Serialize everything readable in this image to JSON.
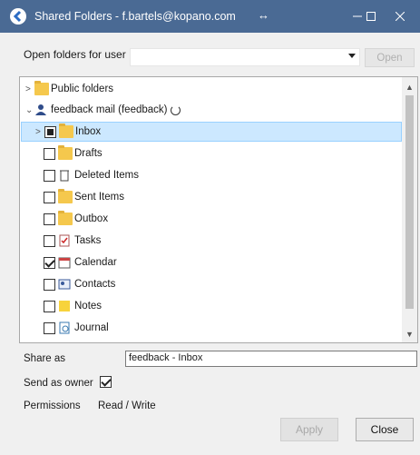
{
  "window": {
    "title": "Shared Folders - f.bartels@kopano.com"
  },
  "open_row": {
    "label": "Open folders for user",
    "input_value": "",
    "open_label": "Open"
  },
  "tree": {
    "public": "Public folders",
    "store": "feedback mail (feedback)",
    "inbox": "Inbox",
    "drafts": "Drafts",
    "deleted": "Deleted Items",
    "sent": "Sent Items",
    "outbox": "Outbox",
    "tasks": "Tasks",
    "calendar": "Calendar",
    "contacts": "Contacts",
    "notes": "Notes",
    "journal": "Journal"
  },
  "form": {
    "share_as_label": "Share as",
    "share_as_value": "feedback - Inbox",
    "send_as_owner_label": "Send as owner",
    "permissions_label": "Permissions",
    "permissions_value": "Read / Write"
  },
  "buttons": {
    "apply": "Apply",
    "close": "Close"
  },
  "colors": {
    "titlebar": "#4a6a94",
    "selection": "#cce8ff"
  }
}
